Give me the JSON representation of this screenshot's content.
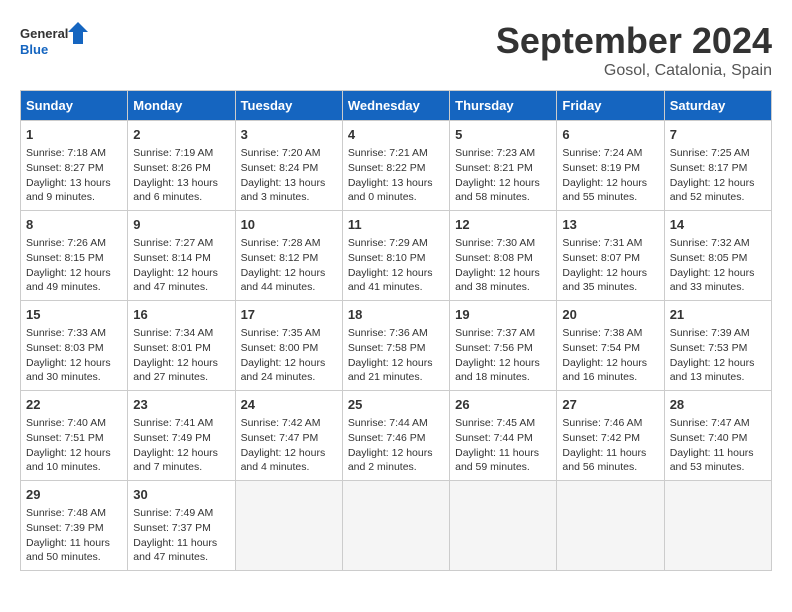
{
  "header": {
    "logo_general": "General",
    "logo_blue": "Blue",
    "month": "September 2024",
    "location": "Gosol, Catalonia, Spain"
  },
  "weekdays": [
    "Sunday",
    "Monday",
    "Tuesday",
    "Wednesday",
    "Thursday",
    "Friday",
    "Saturday"
  ],
  "weeks": [
    [
      {
        "day": "1",
        "lines": [
          "Sunrise: 7:18 AM",
          "Sunset: 8:27 PM",
          "Daylight: 13 hours",
          "and 9 minutes."
        ]
      },
      {
        "day": "2",
        "lines": [
          "Sunrise: 7:19 AM",
          "Sunset: 8:26 PM",
          "Daylight: 13 hours",
          "and 6 minutes."
        ]
      },
      {
        "day": "3",
        "lines": [
          "Sunrise: 7:20 AM",
          "Sunset: 8:24 PM",
          "Daylight: 13 hours",
          "and 3 minutes."
        ]
      },
      {
        "day": "4",
        "lines": [
          "Sunrise: 7:21 AM",
          "Sunset: 8:22 PM",
          "Daylight: 13 hours",
          "and 0 minutes."
        ]
      },
      {
        "day": "5",
        "lines": [
          "Sunrise: 7:23 AM",
          "Sunset: 8:21 PM",
          "Daylight: 12 hours",
          "and 58 minutes."
        ]
      },
      {
        "day": "6",
        "lines": [
          "Sunrise: 7:24 AM",
          "Sunset: 8:19 PM",
          "Daylight: 12 hours",
          "and 55 minutes."
        ]
      },
      {
        "day": "7",
        "lines": [
          "Sunrise: 7:25 AM",
          "Sunset: 8:17 PM",
          "Daylight: 12 hours",
          "and 52 minutes."
        ]
      }
    ],
    [
      {
        "day": "8",
        "lines": [
          "Sunrise: 7:26 AM",
          "Sunset: 8:15 PM",
          "Daylight: 12 hours",
          "and 49 minutes."
        ]
      },
      {
        "day": "9",
        "lines": [
          "Sunrise: 7:27 AM",
          "Sunset: 8:14 PM",
          "Daylight: 12 hours",
          "and 47 minutes."
        ]
      },
      {
        "day": "10",
        "lines": [
          "Sunrise: 7:28 AM",
          "Sunset: 8:12 PM",
          "Daylight: 12 hours",
          "and 44 minutes."
        ]
      },
      {
        "day": "11",
        "lines": [
          "Sunrise: 7:29 AM",
          "Sunset: 8:10 PM",
          "Daylight: 12 hours",
          "and 41 minutes."
        ]
      },
      {
        "day": "12",
        "lines": [
          "Sunrise: 7:30 AM",
          "Sunset: 8:08 PM",
          "Daylight: 12 hours",
          "and 38 minutes."
        ]
      },
      {
        "day": "13",
        "lines": [
          "Sunrise: 7:31 AM",
          "Sunset: 8:07 PM",
          "Daylight: 12 hours",
          "and 35 minutes."
        ]
      },
      {
        "day": "14",
        "lines": [
          "Sunrise: 7:32 AM",
          "Sunset: 8:05 PM",
          "Daylight: 12 hours",
          "and 33 minutes."
        ]
      }
    ],
    [
      {
        "day": "15",
        "lines": [
          "Sunrise: 7:33 AM",
          "Sunset: 8:03 PM",
          "Daylight: 12 hours",
          "and 30 minutes."
        ]
      },
      {
        "day": "16",
        "lines": [
          "Sunrise: 7:34 AM",
          "Sunset: 8:01 PM",
          "Daylight: 12 hours",
          "and 27 minutes."
        ]
      },
      {
        "day": "17",
        "lines": [
          "Sunrise: 7:35 AM",
          "Sunset: 8:00 PM",
          "Daylight: 12 hours",
          "and 24 minutes."
        ]
      },
      {
        "day": "18",
        "lines": [
          "Sunrise: 7:36 AM",
          "Sunset: 7:58 PM",
          "Daylight: 12 hours",
          "and 21 minutes."
        ]
      },
      {
        "day": "19",
        "lines": [
          "Sunrise: 7:37 AM",
          "Sunset: 7:56 PM",
          "Daylight: 12 hours",
          "and 18 minutes."
        ]
      },
      {
        "day": "20",
        "lines": [
          "Sunrise: 7:38 AM",
          "Sunset: 7:54 PM",
          "Daylight: 12 hours",
          "and 16 minutes."
        ]
      },
      {
        "day": "21",
        "lines": [
          "Sunrise: 7:39 AM",
          "Sunset: 7:53 PM",
          "Daylight: 12 hours",
          "and 13 minutes."
        ]
      }
    ],
    [
      {
        "day": "22",
        "lines": [
          "Sunrise: 7:40 AM",
          "Sunset: 7:51 PM",
          "Daylight: 12 hours",
          "and 10 minutes."
        ]
      },
      {
        "day": "23",
        "lines": [
          "Sunrise: 7:41 AM",
          "Sunset: 7:49 PM",
          "Daylight: 12 hours",
          "and 7 minutes."
        ]
      },
      {
        "day": "24",
        "lines": [
          "Sunrise: 7:42 AM",
          "Sunset: 7:47 PM",
          "Daylight: 12 hours",
          "and 4 minutes."
        ]
      },
      {
        "day": "25",
        "lines": [
          "Sunrise: 7:44 AM",
          "Sunset: 7:46 PM",
          "Daylight: 12 hours",
          "and 2 minutes."
        ]
      },
      {
        "day": "26",
        "lines": [
          "Sunrise: 7:45 AM",
          "Sunset: 7:44 PM",
          "Daylight: 11 hours",
          "and 59 minutes."
        ]
      },
      {
        "day": "27",
        "lines": [
          "Sunrise: 7:46 AM",
          "Sunset: 7:42 PM",
          "Daylight: 11 hours",
          "and 56 minutes."
        ]
      },
      {
        "day": "28",
        "lines": [
          "Sunrise: 7:47 AM",
          "Sunset: 7:40 PM",
          "Daylight: 11 hours",
          "and 53 minutes."
        ]
      }
    ],
    [
      {
        "day": "29",
        "lines": [
          "Sunrise: 7:48 AM",
          "Sunset: 7:39 PM",
          "Daylight: 11 hours",
          "and 50 minutes."
        ]
      },
      {
        "day": "30",
        "lines": [
          "Sunrise: 7:49 AM",
          "Sunset: 7:37 PM",
          "Daylight: 11 hours",
          "and 47 minutes."
        ]
      },
      {
        "day": "",
        "lines": []
      },
      {
        "day": "",
        "lines": []
      },
      {
        "day": "",
        "lines": []
      },
      {
        "day": "",
        "lines": []
      },
      {
        "day": "",
        "lines": []
      }
    ]
  ]
}
